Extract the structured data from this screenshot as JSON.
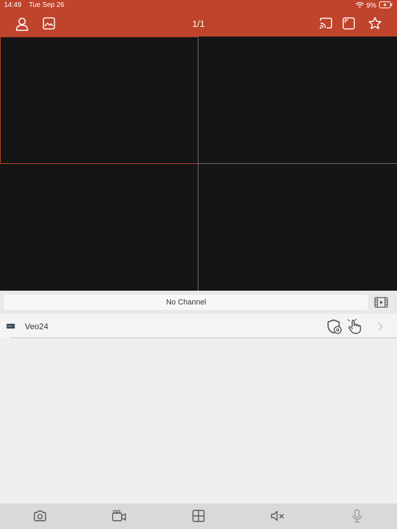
{
  "status_bar": {
    "time": "14:49",
    "date": "Tue Sep 26",
    "battery": "9%"
  },
  "header": {
    "page_indicator": "1/1",
    "left_icons": [
      "user-icon",
      "image-icon"
    ],
    "right_icons": [
      "cast-icon",
      "fullscreen-icon",
      "star-icon"
    ]
  },
  "video_grid": {
    "layout": "2x2",
    "selected_cell": 1
  },
  "channel": {
    "label": "No Channel"
  },
  "device": {
    "name": "Veo24"
  },
  "toolbar": {
    "icons": [
      "camera-icon",
      "record-icon",
      "grid-layout-icon",
      "mute-icon",
      "microphone-icon"
    ]
  },
  "colors": {
    "accent": "#c0442b",
    "video_bg": "#151515",
    "panel_bg": "#efefef"
  }
}
